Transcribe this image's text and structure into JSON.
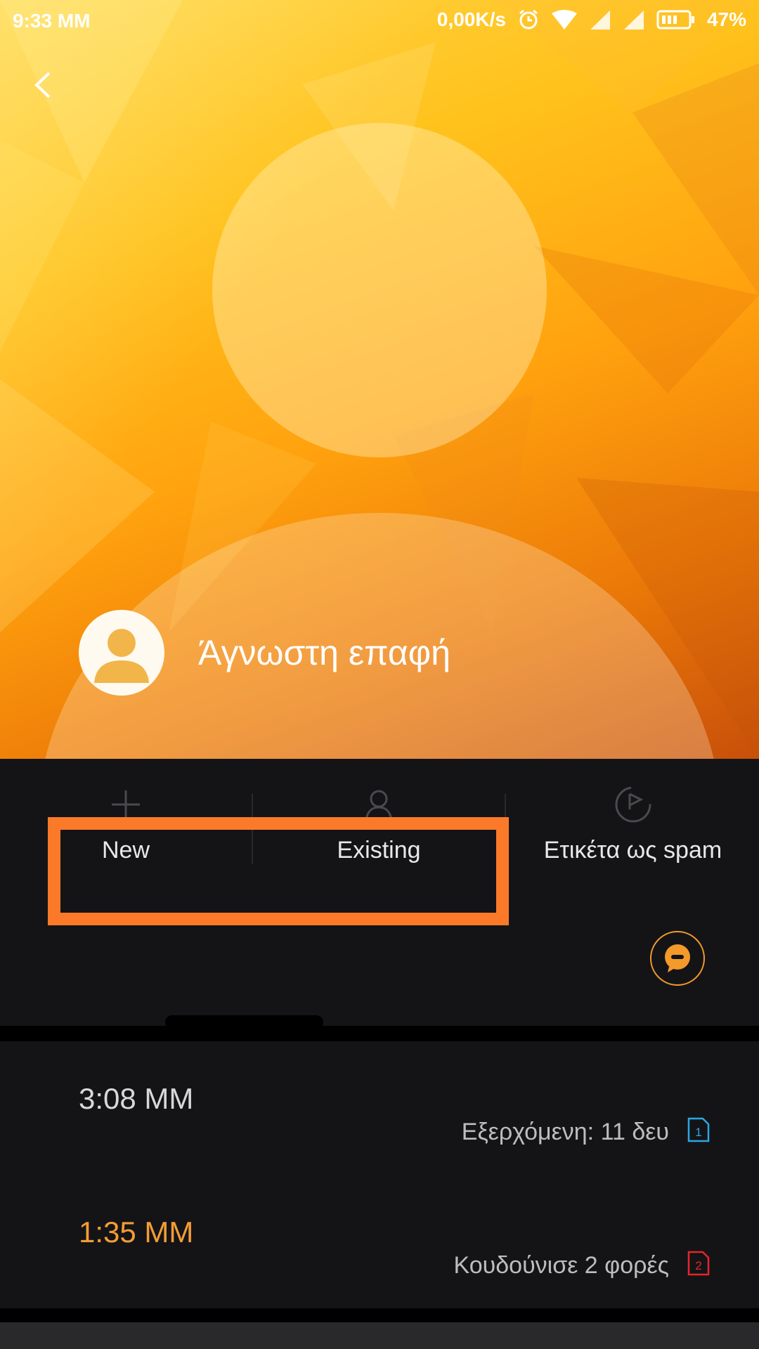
{
  "status_bar": {
    "time": "9:33 MM",
    "speed": "0,00K/s",
    "battery": "47%",
    "icons": [
      "alarm-icon",
      "wifi-icon",
      "signal-icon",
      "signal-icon-2",
      "battery-icon"
    ]
  },
  "contact": {
    "name": "Άγνωστη επαφή"
  },
  "actions": {
    "new_label": "New",
    "existing_label": "Existing",
    "spam_label": "Ετικέτα ως spam"
  },
  "calls": [
    {
      "time": "3:08 MM",
      "detail": "Εξερχόμενη: 11 δευ",
      "sim": "1",
      "missed": false
    },
    {
      "time": "1:35 MM",
      "detail": "Κουδούνισε 2 φορές",
      "sim": "2",
      "missed": true
    }
  ],
  "colors": {
    "accent": "#f59c36",
    "highlight_border": "#fa7a2a",
    "background": "#141417",
    "sim1": "#29a7e6",
    "sim2": "#e5252a"
  }
}
